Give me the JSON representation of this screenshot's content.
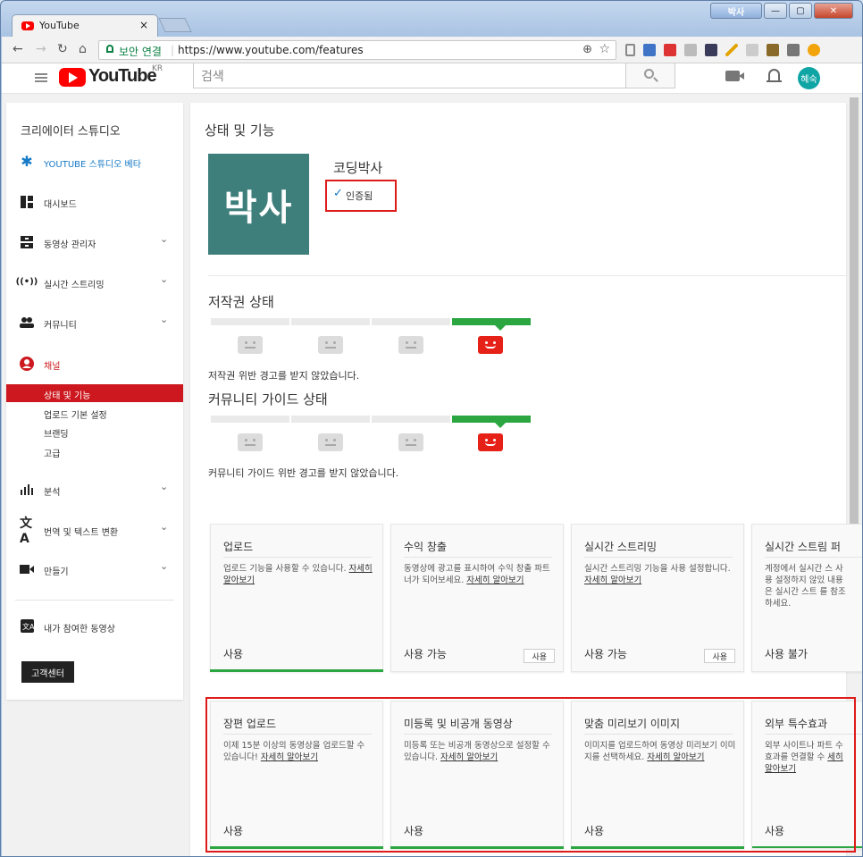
{
  "browser": {
    "tab_title": "YouTube",
    "tab_close": "×",
    "window_user": "박사",
    "security_label": "보안 연결",
    "url": "https://www.youtube.com/features",
    "zoom_icon": "⊕",
    "star_icon": "☆"
  },
  "yt_header": {
    "logo_text": "YouTube",
    "logo_region": "KR",
    "search_placeholder": "검색",
    "avatar_text": "혜숙"
  },
  "sidebar": {
    "title": "크리에이터 스튜디오",
    "items": [
      {
        "label": "YOUTUBE 스튜디오 베타",
        "icon": "gear-icon",
        "color": "#167ac6"
      },
      {
        "label": "대시보드",
        "icon": "dashboard-icon"
      },
      {
        "label": "동영상 관리자",
        "icon": "video-manager-icon",
        "chevron": "⌄"
      },
      {
        "label": "실시간 스트리밍",
        "icon": "live-icon",
        "chevron": "⌄"
      },
      {
        "label": "커뮤니티",
        "icon": "community-icon",
        "chevron": "⌄"
      },
      {
        "label": "채널",
        "icon": "channel-icon",
        "color": "#cc181e"
      }
    ],
    "channel_sub": [
      "상태 및 기능",
      "업로드 기본 설정",
      "브랜딩",
      "고급"
    ],
    "lower_items": [
      {
        "label": "분석",
        "icon": "analytics-icon",
        "chevron": "⌄"
      },
      {
        "label": "번역 및 텍스트 변환",
        "icon": "translate-icon",
        "chevron": "⌄"
      },
      {
        "label": "만들기",
        "icon": "create-icon",
        "chevron": "⌄"
      }
    ],
    "contributed": "내가 참여한 동영상",
    "help_button": "고객센터"
  },
  "main": {
    "title": "상태 및 기능",
    "channel_thumb_text": "박사",
    "channel_name": "코딩박사",
    "verified_check": "✓",
    "verified_label": "인증됨",
    "copyright_heading": "저작권 상태",
    "copyright_note": "저작권 위반 경고를 받지 않았습니다.",
    "community_heading": "커뮤니티 가이드 상태",
    "community_note": "커뮤니티 가이드 위반 경고를 받지 않았습니다.",
    "strike_level": 0,
    "accent_green": "#2ba640",
    "accent_red": "#e62117"
  },
  "features_row1": [
    {
      "title": "업로드",
      "desc": "업로드 기능을 사용할 수 있습니다.",
      "link": "자세히 알아보기",
      "status": "사용",
      "button": "",
      "enabled": true
    },
    {
      "title": "수익 창출",
      "desc": "동영상에 광고를 표시하여 수익 창출 파트너가 되어보세요.",
      "link": "자세히 알아보기",
      "status": "사용 가능",
      "button": "사용",
      "enabled": false
    },
    {
      "title": "실시간 스트리밍",
      "desc": "실시간 스트리밍 기능을 사용 설정합니다.",
      "link": "자세히 알아보기",
      "status": "사용 가능",
      "button": "사용",
      "enabled": false
    },
    {
      "title": "실시간 스트림 퍼",
      "desc": "계정에서 실시간 스 사용 설정하지 않있 내용은 실시간 스트 를 참조하세요.",
      "link": "",
      "status": "사용 불가",
      "button": "",
      "enabled": false
    }
  ],
  "features_row2": [
    {
      "title": "장편 업로드",
      "desc": "이제 15분 이상의 동영상을 업로드할 수 있습니다!",
      "link": "자세히 알아보기",
      "status": "사용",
      "enabled": true
    },
    {
      "title": "미등록 및 비공개 동영상",
      "desc": "미등록 또는 비공개 동영상으로 설정할 수 있습니다.",
      "link": "자세히 알아보기",
      "status": "사용",
      "enabled": true
    },
    {
      "title": "맞춤 미리보기 이미지",
      "desc": "이미지를 업로드하여 동영상 미리보기 이미지를 선택하세요.",
      "link": "자세히 알아보기",
      "status": "사용",
      "enabled": true
    },
    {
      "title": "외부 특수효과",
      "desc": "외부 사이트나 파트 수효과를 연결할 수",
      "link": "세히 알아보기",
      "status": "사용",
      "enabled": true
    }
  ]
}
